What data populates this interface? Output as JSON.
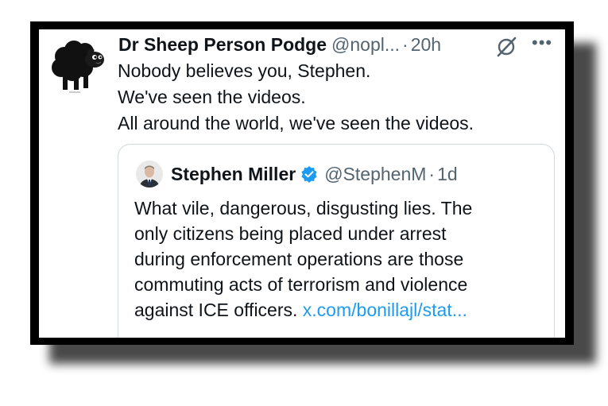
{
  "tweet": {
    "author_name": "Dr Sheep Person Podge",
    "handle": "@nopl...",
    "separator": "·",
    "time": "20h",
    "more_label": "•••",
    "text_lines": [
      "Nobody believes you, Stephen.",
      "We've seen the videos.",
      "All around the world, we've seen the videos."
    ]
  },
  "quoted": {
    "author_name": "Stephen Miller",
    "handle": "@StephenM",
    "separator": "·",
    "time": "1d",
    "text_lines": [
      "What vile, dangerous, disgusting lies. The",
      "only citizens being placed under arrest",
      "during enforcement operations are those",
      "commuting acts of terrorism and violence",
      "against ICE officers."
    ],
    "link_text": "x.com/bonillajl/stat..."
  },
  "icons": {
    "avatar": "black-sheep-avatar",
    "grok": "grok-icon",
    "more": "more-icon",
    "verified": "verified-badge-icon"
  },
  "colors": {
    "text": "#0f1419",
    "secondary": "#536471",
    "link": "#1d9bf0",
    "frame": "#000000"
  }
}
